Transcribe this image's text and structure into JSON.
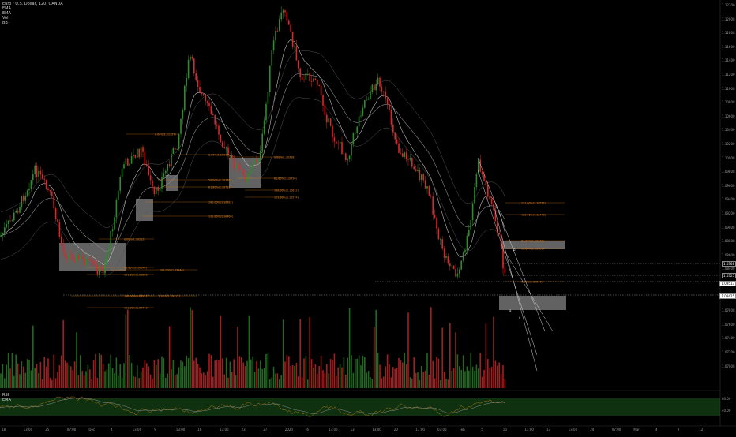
{
  "legend": {
    "title": "Euro / U.S. Dollar, 120, OANDA",
    "lines": [
      "EMA",
      "EMA",
      "Vol",
      "BB"
    ]
  },
  "rsi_labels": [
    "RSI",
    "EMA"
  ],
  "price_axis": {
    "ticks": [
      "1.12200",
      "1.12000",
      "1.11800",
      "1.11600",
      "1.11400",
      "1.11200",
      "1.11000",
      "1.10800",
      "1.10600",
      "1.10400",
      "1.10200",
      "1.10000",
      "1.09800",
      "1.09600",
      "1.09400",
      "1.09200",
      "1.09000",
      "1.08800",
      "1.08600",
      "1.08400",
      "1.08200",
      "1.08000",
      "1.07800",
      "1.07600",
      "1.07400",
      "1.07200",
      "1.07000"
    ],
    "tags": [
      {
        "text": "1.0368",
        "color": "#ffffff",
        "bg": "#000000"
      },
      {
        "text": "1.0325",
        "color": "#ffffff",
        "bg": "#000000"
      },
      {
        "text": "1.09513",
        "color": "#000000",
        "bg": "#ffffff"
      },
      {
        "text": "1.09425",
        "color": "#000000",
        "bg": "#ffffff"
      }
    ],
    "rsi_ticks": [
      "80.00",
      "40.00"
    ]
  },
  "time_axis": [
    "18",
    "13:00",
    "25",
    "07:00",
    "Dec",
    "4",
    "13:00",
    "9",
    "13:00",
    "16",
    "13:00",
    "23",
    "27",
    "2020",
    "6",
    "13:00",
    "13",
    "13:00",
    "20",
    "13:00",
    "07:00",
    "Feb",
    "5",
    "10",
    "13:00",
    "17",
    "13:00",
    "24",
    "07:00",
    "Mar",
    "4",
    "9",
    "12"
  ],
  "fib_labels": [
    {
      "text": "0.00%(1.11127)"
    },
    {
      "text": "0.00%(1.10915)"
    },
    {
      "text": "50.00%(1.10760)"
    },
    {
      "text": "61.80%(1.10712)"
    },
    {
      "text": "100.00%(1.10582)"
    },
    {
      "text": "121.80%(1.10460)"
    },
    {
      "text": "0.00%(1.10928)"
    },
    {
      "text": "61.80%(1.10750)"
    },
    {
      "text": "100.00%(1.10622)"
    },
    {
      "text": "121.80%(1.10574)"
    },
    {
      "text": "0.00%(1.10202)"
    },
    {
      "text": "61.80%(1.10048)"
    },
    {
      "text": "100.00%(1.09940)"
    },
    {
      "text": "121.80%(1.09883)"
    },
    {
      "text": "100.00%(1.09917)"
    },
    {
      "text": "121.80%(1.09713)"
    },
    {
      "text": "0.00%(1.09964)"
    },
    {
      "text": "121.80%(1.10555)"
    },
    {
      "text": "100.00%(1.10478)"
    },
    {
      "text": "61.80%(1.10049)"
    },
    {
      "text": "50.00%(1.10021)"
    },
    {
      "text": "0.00%(1.09913)"
    }
  ],
  "wave_labels": [
    "a",
    "b",
    "c"
  ],
  "colors": {
    "background": "#000000",
    "up": "#2e8b2e",
    "down": "#d8282b",
    "fib": "#e07f1a",
    "zone": "#d9d9d9",
    "rsi_band": "#1b5a1b",
    "rsi_line": "#b07c1e"
  }
}
